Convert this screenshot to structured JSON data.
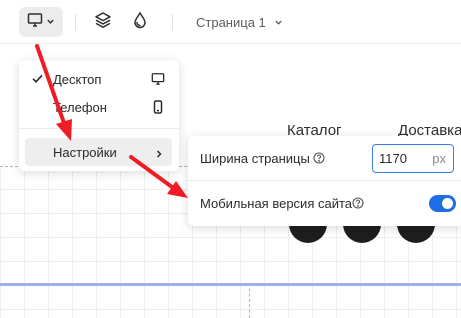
{
  "toolbar": {
    "device_icon": "desktop-monitor-icon",
    "layers_icon": "layers-icon",
    "drop_icon": "drop-icon",
    "page_selector": "Страница 1"
  },
  "canvas": {
    "nav": [
      "Каталог",
      "Доставка"
    ]
  },
  "device_menu": {
    "items": [
      {
        "label": "Десктоп",
        "checked": true,
        "icon": "monitor-icon"
      },
      {
        "label": "Телефон",
        "checked": false,
        "icon": "phone-icon"
      }
    ],
    "settings_label": "Настройки"
  },
  "settings_panel": {
    "page_width_label": "Ширина страницы",
    "page_width_value": "1170",
    "page_width_unit": "px",
    "mobile_label": "Мобильная версия сайта",
    "mobile_enabled": true
  },
  "colors": {
    "accent": "#1e6ee6",
    "annotation_arrow": "#ee1c24"
  }
}
